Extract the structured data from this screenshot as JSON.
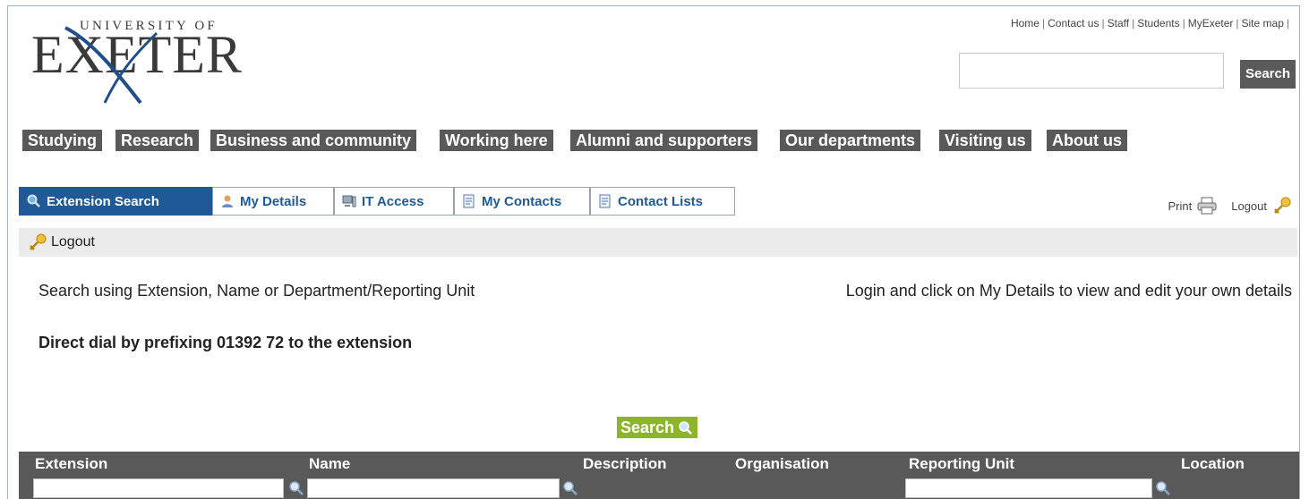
{
  "logo": {
    "top_text": "UNIVERSITY OF",
    "main_text": "EXETER"
  },
  "utility_links": [
    "Home",
    "Contact us",
    "Staff",
    "Students",
    "MyExeter",
    "Site map"
  ],
  "site_search": {
    "value": "",
    "button_label": "Search"
  },
  "main_nav": [
    "Studying",
    "Research",
    "Business and community",
    "Working here",
    "Alumni and supporters",
    "Our departments",
    "Visiting us",
    "About us"
  ],
  "tabs": [
    {
      "label": "Extension Search",
      "icon": "magnifier-icon",
      "active": true
    },
    {
      "label": "My Details",
      "icon": "person-icon",
      "active": false
    },
    {
      "label": "IT Access",
      "icon": "computer-icon",
      "active": false
    },
    {
      "label": "My Contacts",
      "icon": "document-icon",
      "active": false
    },
    {
      "label": "Contact Lists",
      "icon": "document-icon",
      "active": false
    }
  ],
  "print_label": "Print",
  "logout_label": "Logout",
  "logout_bar_label": "Logout",
  "intro_left": "Search using Extension, Name or Department/Reporting Unit",
  "intro_right": "Login and click on My Details to view and edit your own details",
  "direct_dial": "Direct dial by prefixing 01392 72 to the extension",
  "search_button": "Search",
  "table": {
    "columns": [
      "Extension",
      "Name",
      "Description",
      "Organisation",
      "Reporting Unit",
      "Location"
    ],
    "filters": {
      "extension": "",
      "name": "",
      "reporting_unit": ""
    }
  },
  "colors": {
    "nav_bg": "#595959",
    "tab_active": "#1f5a96",
    "search_green": "#8cb52a"
  }
}
